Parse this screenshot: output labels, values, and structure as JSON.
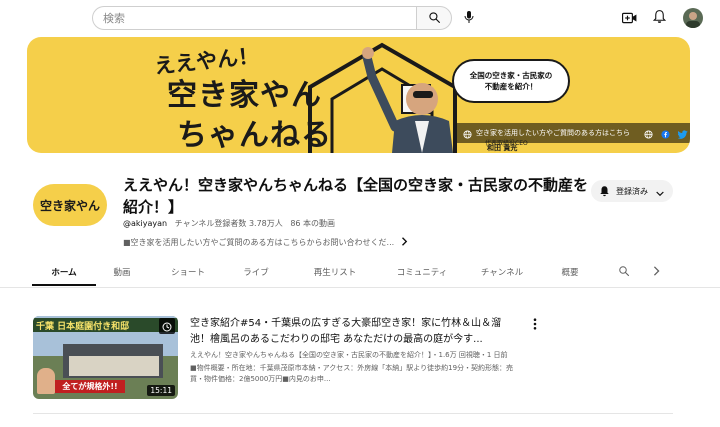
{
  "search": {
    "placeholder": "検索"
  },
  "topbar": {
    "icons": [
      "search-icon",
      "mic-icon",
      "create-video-icon",
      "notifications-icon"
    ]
  },
  "banner": {
    "headline_small": "ええやん！",
    "headline_line1": "空き家やん",
    "headline_line2": "ちゃんねる",
    "speech_bubble": "全国の空き家・古民家の\n不動産を紹介！",
    "link_text": "空き家を活用したい方やご質問のある方はこちら",
    "caption": "代表取締役CEO",
    "name": "和田 貴光"
  },
  "channel": {
    "avatar_text": "空き家やん",
    "title": "ええやん！空き家やんちゃんねる【全国の空き家・古民家の不動産を紹介！】",
    "handle": "@akiyayan",
    "subscribers": "チャンネル登録者数 3.78万人",
    "video_count": "86 本の動画",
    "description": "■空き家を活用したい方やご質問のある方はこちらからお問い合わせくだ...",
    "subscribe_label": "登録済み"
  },
  "tabs": [
    {
      "label": "ホーム"
    },
    {
      "label": "動画"
    },
    {
      "label": "ショート"
    },
    {
      "label": "ライブ"
    },
    {
      "label": "再生リスト"
    },
    {
      "label": "コミュニティ"
    },
    {
      "label": "チャンネル"
    },
    {
      "label": "概要"
    }
  ],
  "video": {
    "thumb_title": "千葉 日本庭園付き和邸",
    "thumb_bottom": "全てが規格外!!",
    "duration": "15:11",
    "title": "空き家紹介#54・千葉県の広すぎる大豪邸空き家！家に竹林＆山＆溜池！檜風呂のあるこだわりの邸宅 あなただけの最高の庭が今す...",
    "meta": "ええやん！空き家やんちゃんねる【全国の空き家・古民家の不動産を紹介！】・1.6万 回視聴・1 日前",
    "description": "■物件概要・所在地：千葉県茂原市本納・アクセス：外房線「本納」駅より徒歩約19分・契約形態：売買・物件価格：2億5000万円■内見のお申..."
  }
}
